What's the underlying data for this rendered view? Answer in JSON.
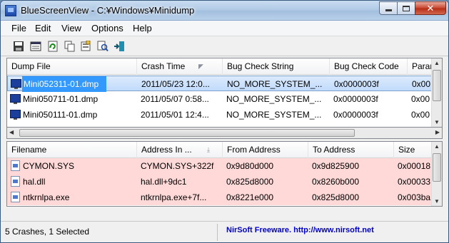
{
  "window": {
    "title": "BlueScreenView  -  C:¥Windows¥Minidump"
  },
  "menu": [
    "File",
    "Edit",
    "View",
    "Options",
    "Help"
  ],
  "toolbar": {
    "buttons": [
      "save-icon",
      "html-report-icon",
      "refresh-icon",
      "copy-icon",
      "properties-icon",
      "find-icon",
      "exit-icon"
    ]
  },
  "top_table": {
    "columns": [
      "Dump File",
      "Crash Time",
      "Bug Check String",
      "Bug Check Code",
      "Parar"
    ],
    "rows": [
      {
        "file": "Mini052311-01.dmp",
        "time": "2011/05/23 12:0...",
        "bug_string": "NO_MORE_SYSTEM_...",
        "bug_code": "0x0000003f",
        "param": "0x00",
        "selected": true
      },
      {
        "file": "Mini050711-01.dmp",
        "time": "2011/05/07 0:58...",
        "bug_string": "NO_MORE_SYSTEM_...",
        "bug_code": "0x0000003f",
        "param": "0x00",
        "selected": false
      },
      {
        "file": "Mini050111-01.dmp",
        "time": "2011/05/01 12:4...",
        "bug_string": "NO_MORE_SYSTEM_...",
        "bug_code": "0x0000003f",
        "param": "0x00",
        "selected": false
      }
    ]
  },
  "bottom_table": {
    "columns": [
      "Filename",
      "Address In ...",
      "From Address",
      "To Address",
      "Size"
    ],
    "rows": [
      {
        "file": "CYMON.SYS",
        "address": "CYMON.SYS+322f",
        "from": "0x9d80d000",
        "to": "0x9d825900",
        "size": "0x00018"
      },
      {
        "file": "hal.dll",
        "address": "hal.dll+9dc1",
        "from": "0x825d8000",
        "to": "0x8260b000",
        "size": "0x00033"
      },
      {
        "file": "ntkrnlpa.exe",
        "address": "ntkrnlpa.exe+7f...",
        "from": "0x8221e000",
        "to": "0x825d8000",
        "size": "0x003ba"
      }
    ]
  },
  "status": {
    "left": "5 Crashes, 1 Selected",
    "right": "NirSoft Freeware.  http://www.nirsoft.net"
  },
  "colors": {
    "selected_row": "#3399ff",
    "highlight_row": "#ffd8d8",
    "link": "#0000cc"
  }
}
